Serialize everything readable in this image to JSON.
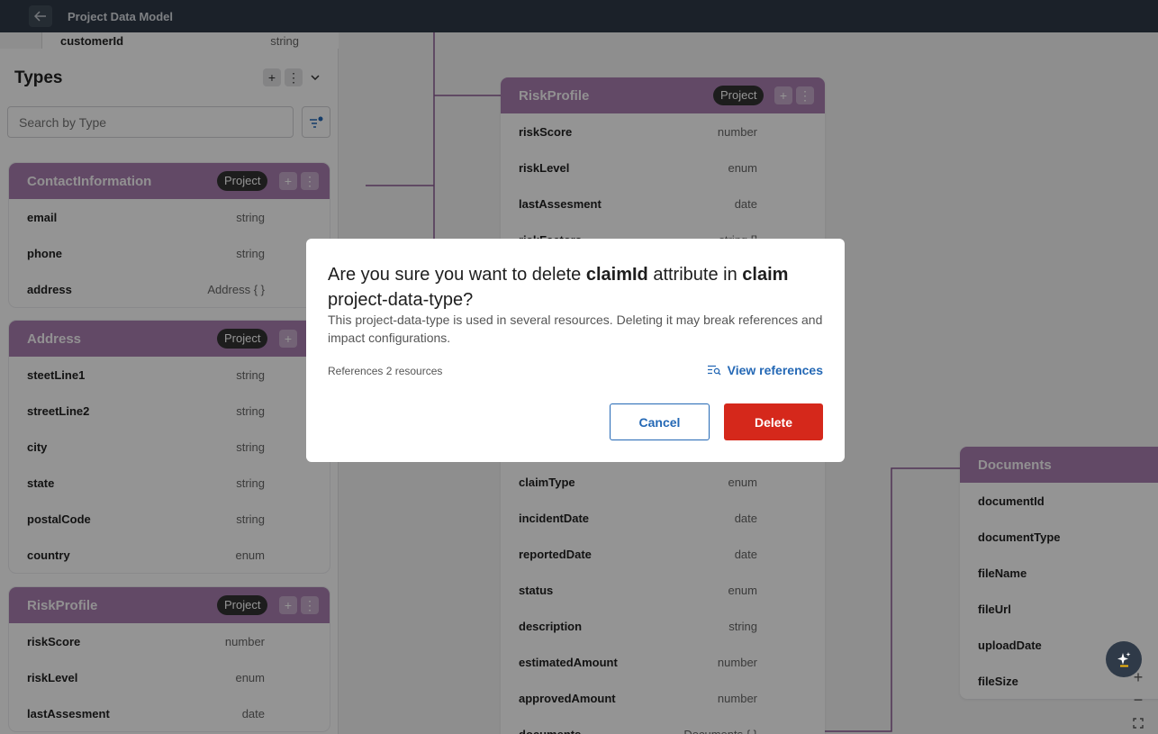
{
  "topbar": {
    "title": "Project Data Model"
  },
  "panel": {
    "title": "Types",
    "search_placeholder": "Search by Type",
    "partial_row": {
      "name": "customerId",
      "type": "string"
    },
    "cards": [
      {
        "name": "ContactInformation",
        "badge": "Project",
        "rows": [
          {
            "name": "email",
            "type": "string"
          },
          {
            "name": "phone",
            "type": "string"
          },
          {
            "name": "address",
            "type": "Address { }"
          }
        ]
      },
      {
        "name": "Address",
        "badge": "Project",
        "rows": [
          {
            "name": "steetLine1",
            "type": "string"
          },
          {
            "name": "streetLine2",
            "type": "string"
          },
          {
            "name": "city",
            "type": "string"
          },
          {
            "name": "state",
            "type": "string"
          },
          {
            "name": "postalCode",
            "type": "string"
          },
          {
            "name": "country",
            "type": "enum"
          }
        ]
      },
      {
        "name": "RiskProfile",
        "badge": "Project",
        "rows": [
          {
            "name": "riskScore",
            "type": "number"
          },
          {
            "name": "riskLevel",
            "type": "enum"
          },
          {
            "name": "lastAssesment",
            "type": "date"
          }
        ]
      }
    ]
  },
  "canvas": {
    "risk_profile": {
      "name": "RiskProfile",
      "badge": "Project",
      "rows": [
        {
          "name": "riskScore",
          "type": "number"
        },
        {
          "name": "riskLevel",
          "type": "enum"
        },
        {
          "name": "lastAssesment",
          "type": "date"
        },
        {
          "name": "riskFactors",
          "type": "string []"
        }
      ]
    },
    "claim": {
      "rows": [
        {
          "name": "claimType",
          "type": "enum"
        },
        {
          "name": "incidentDate",
          "type": "date"
        },
        {
          "name": "reportedDate",
          "type": "date"
        },
        {
          "name": "status",
          "type": "enum"
        },
        {
          "name": "description",
          "type": "string"
        },
        {
          "name": "estimatedAmount",
          "type": "number"
        },
        {
          "name": "approvedAmount",
          "type": "number"
        },
        {
          "name": "documents",
          "type": "Documents { }"
        }
      ]
    },
    "documents": {
      "name": "Documents",
      "rows": [
        {
          "name": "documentId"
        },
        {
          "name": "documentType"
        },
        {
          "name": "fileName"
        },
        {
          "name": "fileUrl"
        },
        {
          "name": "uploadDate"
        },
        {
          "name": "fileSize"
        }
      ]
    }
  },
  "dialog": {
    "title_prefix": "Are you sure you want to delete ",
    "attribute": "claimId",
    "title_middle": " attribute in ",
    "type_name": "claim",
    "title_suffix": " project-data-type?",
    "description": "This project-data-type is used in several resources. Deleting it may break references and impact configurations.",
    "references": "References 2 resources",
    "view_references": "View references",
    "cancel_label": "Cancel",
    "delete_label": "Delete"
  },
  "zoom": {
    "plus": "+",
    "minus": "−"
  },
  "colors": {
    "header_purple": "#a97fb0",
    "topbar": "#2f3a48",
    "danger": "#d5281b",
    "link": "#2468b5"
  }
}
